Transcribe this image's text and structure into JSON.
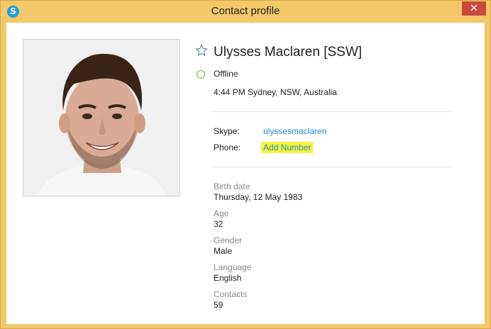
{
  "window": {
    "title": "Contact profile",
    "close_glyph": "✕",
    "app_icon_letter": "S"
  },
  "profile": {
    "name": "Ulysses Maclaren [SSW]",
    "status": "Offline",
    "local_time": "4:44 PM Sydney, NSW, Australia",
    "skype_label": "Skype:",
    "skype_value": "ulyssesmaclaren",
    "phone_label": "Phone:",
    "phone_value": "Add Number"
  },
  "details": [
    {
      "label": "Birth date",
      "value": "Thursday, 12 May 1983"
    },
    {
      "label": "Age",
      "value": "32"
    },
    {
      "label": "Gender",
      "value": "Male"
    },
    {
      "label": "Language",
      "value": "English"
    },
    {
      "label": "Contacts",
      "value": "59"
    }
  ],
  "colors": {
    "window_frame": "#f2c86a",
    "close_button": "#c84a3f",
    "link": "#1a8fd0",
    "highlight": "#f5f53a",
    "online_ring": "#6bbf2a"
  },
  "icons": {
    "app": "skype-logo-icon",
    "favorite": "star-outline-icon",
    "status": "offline-status-icon",
    "close": "close-icon"
  }
}
